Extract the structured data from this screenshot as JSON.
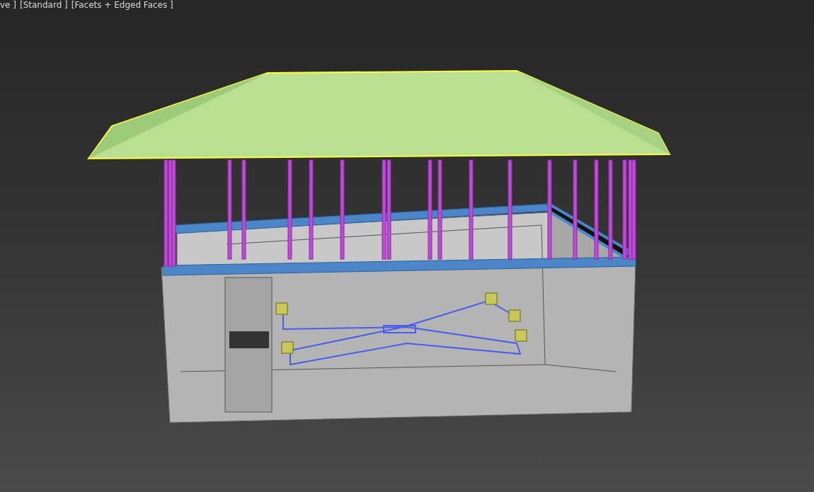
{
  "viewport": {
    "labels": [
      {
        "text": "ve ]"
      },
      {
        "text": "[Standard ]"
      },
      {
        "text": "[Facets + Edged Faces ]"
      }
    ]
  }
}
